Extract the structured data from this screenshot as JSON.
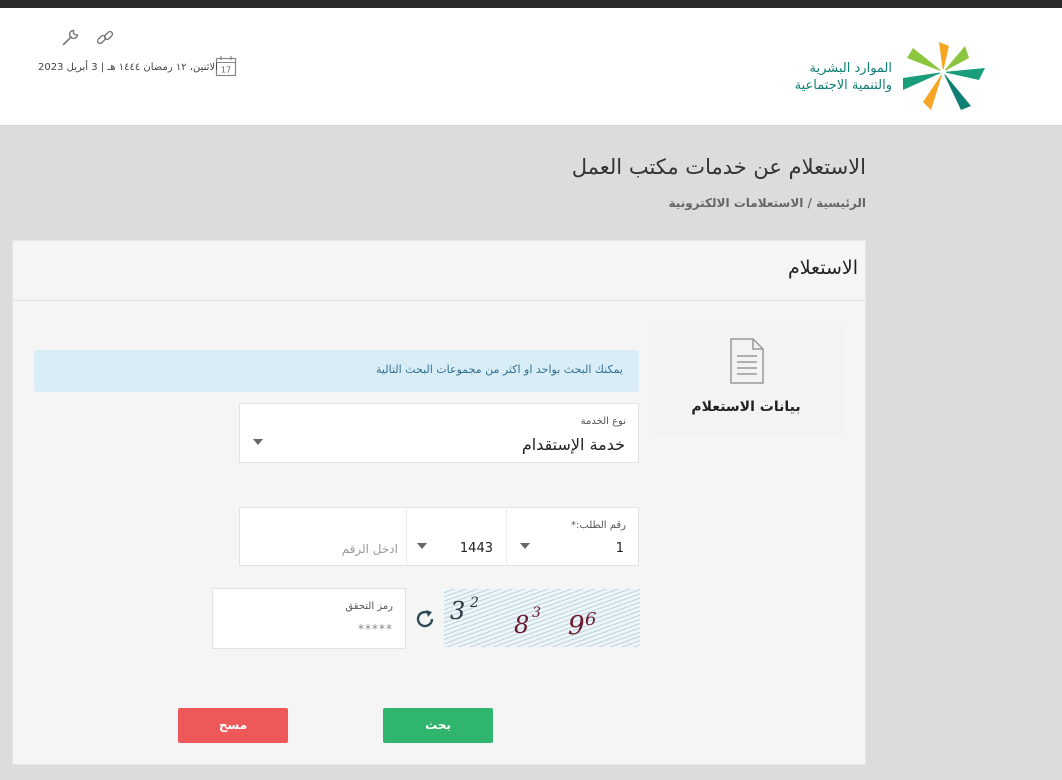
{
  "header": {
    "logo_line1": "الموارد البشرية",
    "logo_line2": "والتنمية الاجتماعية",
    "calendar_day": "17",
    "date": "الاثنين، ١٢ رمضان ١٤٤٤ هـ | 3 أبريل 2023",
    "icons": [
      "wrench-icon",
      "link-icon",
      "calendar-icon"
    ],
    "logo_colors": [
      "#1a9d7a",
      "#f5a623",
      "#8cc63f",
      "#0f7f74"
    ]
  },
  "page": {
    "title": "الاستعلام عن خدمات مكتب العمل",
    "breadcrumb": "الرئيسية / الاستعلامات الالكترونية"
  },
  "panel": {
    "title": "الاستعلام",
    "side_card_label": "بيانات الاستعلام",
    "info_message": "يمكنك البحث بواحد او اكثر من مجموعات البحث التالية"
  },
  "form": {
    "service_type": {
      "label": "نوع الخدمة",
      "value": "خدمة الإستقدام"
    },
    "request_number": {
      "label": "رقم الطلب:*",
      "prefix_value": "1",
      "year_value": "1443",
      "number_placeholder": "ادخل الرقم"
    },
    "captcha": {
      "chars": [
        "3",
        "2",
        "8",
        "3",
        "9",
        "6"
      ],
      "code_label": "رمز التحقق",
      "code_placeholder": "*****"
    }
  },
  "buttons": {
    "search": "بحث",
    "clear": "مسح"
  },
  "colors": {
    "primary_green": "#2fb56e",
    "danger_red": "#ef5858",
    "info_bg": "#d9edf7",
    "info_text": "#31708f"
  }
}
